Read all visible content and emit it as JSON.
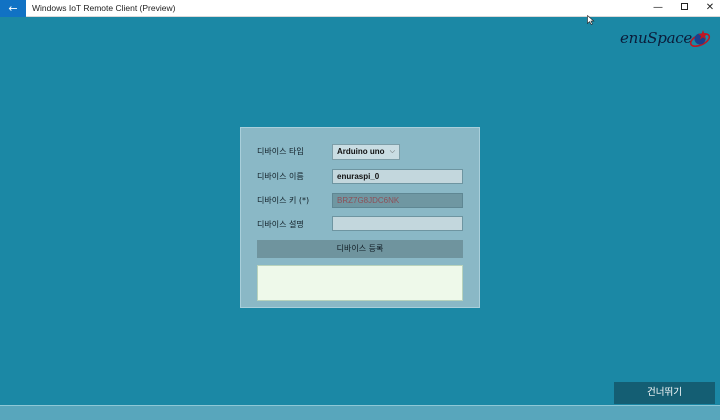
{
  "window": {
    "title": "Windows IoT Remote Client (Preview)",
    "back_glyph": "←",
    "minimize_glyph": "—",
    "close_glyph": "✕"
  },
  "logo": {
    "text": "enuSpace"
  },
  "form": {
    "device_type": {
      "label": "디바이스 타입",
      "selected": "Arduino uno",
      "chevron": "⌵"
    },
    "device_name": {
      "label": "디바이스 이름",
      "value": "enuraspi_0"
    },
    "device_key": {
      "label": "디바이스 키 (*)",
      "value": "BRZ7G8JDC6NK"
    },
    "device_description": {
      "label": "디바이스 설명",
      "value": ""
    },
    "register_button_label": "디바이스 등록",
    "log_text": ""
  },
  "skip_button_label": "건너뛰기",
  "colors": {
    "background": "#1b88a5",
    "accent_back": "#1172c4",
    "panel": "#8ab8c6",
    "skip_button": "#145e73",
    "log_area": "#eef9ea"
  }
}
